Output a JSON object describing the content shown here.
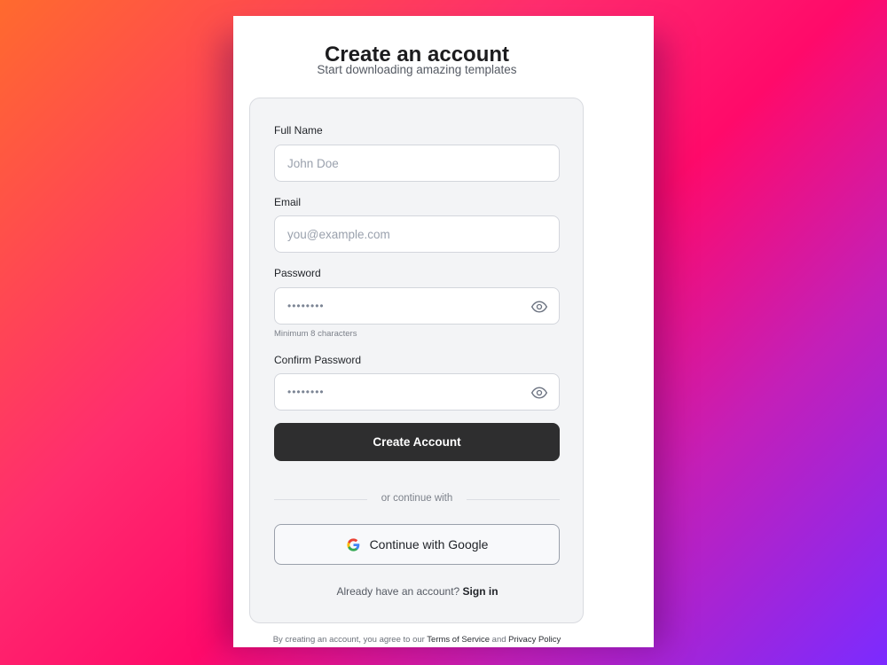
{
  "header": {
    "title": "Create an account",
    "subtitle": "Start downloading amazing templates"
  },
  "form": {
    "full_name": {
      "label": "Full Name",
      "placeholder": "John Doe"
    },
    "email": {
      "label": "Email",
      "placeholder": "you@example.com"
    },
    "password": {
      "label": "Password",
      "value_masked": "••••••••",
      "hint": "Minimum 8 characters"
    },
    "confirm_password": {
      "label": "Confirm Password",
      "value_masked": "••••••••"
    },
    "submit_label": "Create Account"
  },
  "divider_text": "or continue with",
  "google_button_label": "Continue with Google",
  "signin": {
    "prompt": "Already have an account?",
    "link": "Sign in"
  },
  "terms": {
    "prefix": "By creating an account, you agree to our",
    "tos": "Terms of Service",
    "and": "and",
    "privacy": "Privacy Policy"
  },
  "icons": {
    "password_toggle": "eye-icon",
    "google": "google-icon"
  },
  "colors": {
    "primary_button": "#2e2e2f",
    "background_gradient": [
      "#ff6a2e",
      "#ff0a6a",
      "#7b2bff"
    ]
  }
}
